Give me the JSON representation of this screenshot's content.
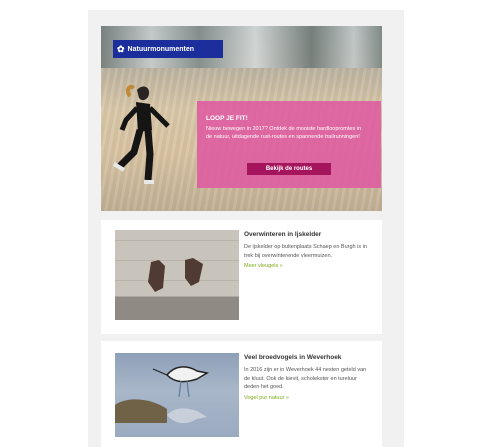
{
  "hero": {
    "brand": "Natuurmonumenten",
    "title": "LOOP JE FIT!",
    "text": "Nieuw bewegen in 2017? Ontdek de mooiste hardloopromtes in de natuur, uitdagende rust-routes en spannende trailrunningen!",
    "cta": "Bekijk de routes"
  },
  "articles": [
    {
      "title": "Overwinteren in Ijskelder",
      "text": "De ijskelder op buitenplaats Schaep en Burgh is in trek bij overwinterende vleermuizen.",
      "link": "Meer vleugels »"
    },
    {
      "title": "Veel broedvogels in Weverhoek",
      "text": "In 2016 zijn er in Weverhoek 44 nesten geteld van de kluut. Ook de kievit, scholekster en tureluur deden het goed.",
      "link": "Vogel pur natuur »"
    }
  ],
  "colors": {
    "brand_blue": "#1b2e9b",
    "pink_panel": "#de5aa0",
    "cta": "#a5155e",
    "link_green": "#7cab1b"
  }
}
